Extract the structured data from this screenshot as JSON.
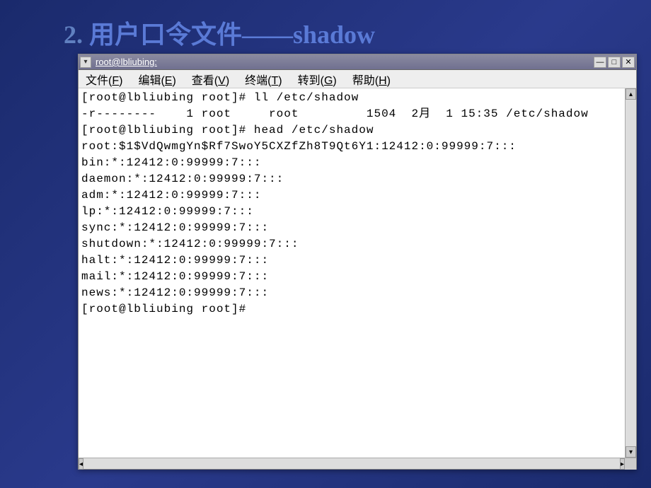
{
  "slide": {
    "num": "2.",
    "title": "用户口令文件——shadow"
  },
  "window": {
    "title": "root@lbliubing:",
    "buttons": {
      "min": "—",
      "max": "□",
      "close": "✕"
    },
    "menu_icon": "▾"
  },
  "menubar": {
    "file": {
      "text": "文件(",
      "key": "F",
      "after": ")"
    },
    "edit": {
      "text": "编辑(",
      "key": "E",
      "after": ")"
    },
    "view": {
      "text": "查看(",
      "key": "V",
      "after": ")"
    },
    "terminal": {
      "text": "终端(",
      "key": "T",
      "after": ")"
    },
    "goto": {
      "text": "转到(",
      "key": "G",
      "after": ")"
    },
    "help": {
      "text": "帮助(",
      "key": "H",
      "after": ")"
    }
  },
  "scroll": {
    "up": "▴",
    "down": "▾",
    "left": "◂",
    "right": "▸"
  },
  "terminal_lines": {
    "l0": "[root@lbliubing root]# ll /etc/shadow",
    "l1": "-r--------    1 root     root         1504  2月  1 15:35 /etc/shadow",
    "l2": "[root@lbliubing root]# head /etc/shadow",
    "l3": "root:$1$VdQwmgYn$Rf7SwoY5CXZfZh8T9Qt6Y1:12412:0:99999:7:::",
    "l4": "bin:*:12412:0:99999:7:::",
    "l5": "daemon:*:12412:0:99999:7:::",
    "l6": "adm:*:12412:0:99999:7:::",
    "l7": "lp:*:12412:0:99999:7:::",
    "l8": "sync:*:12412:0:99999:7:::",
    "l9": "shutdown:*:12412:0:99999:7:::",
    "l10": "halt:*:12412:0:99999:7:::",
    "l11": "mail:*:12412:0:99999:7:::",
    "l12": "news:*:12412:0:99999:7:::",
    "l13": "[root@lbliubing root]#"
  }
}
